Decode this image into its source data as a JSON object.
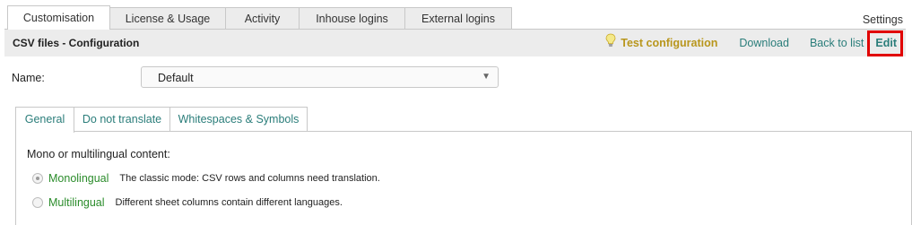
{
  "top_tabs": [
    {
      "label": "Customisation",
      "active": true
    },
    {
      "label": "License & Usage",
      "active": false
    },
    {
      "label": "Activity",
      "active": false
    },
    {
      "label": "Inhouse logins",
      "active": false
    },
    {
      "label": "External logins",
      "active": false
    }
  ],
  "settings_label": "Settings",
  "header": {
    "title": "CSV files - Configuration",
    "actions": {
      "test": "Test configuration",
      "download": "Download",
      "back": "Back to list",
      "edit": "Edit"
    }
  },
  "name_field": {
    "label": "Name:",
    "value": "Default"
  },
  "sub_tabs": [
    {
      "label": "General",
      "active": true
    },
    {
      "label": "Do not translate",
      "active": false
    },
    {
      "label": "Whitespaces & Symbols",
      "active": false
    }
  ],
  "content": {
    "section_label": "Mono or multilingual content:",
    "options": [
      {
        "name": "Monolingual",
        "desc": "The classic mode: CSV rows and columns need translation.",
        "selected": true
      },
      {
        "name": "Multilingual",
        "desc": "Different sheet columns contain different languages.",
        "selected": false
      }
    ]
  },
  "colors": {
    "link": "#2a7d7a",
    "test": "#b8961c",
    "highlight_border": "#e10000",
    "option_green": "#2b8c2b"
  },
  "icons": {
    "test": "lightbulb-icon",
    "dropdown": "chevron-down-icon"
  }
}
